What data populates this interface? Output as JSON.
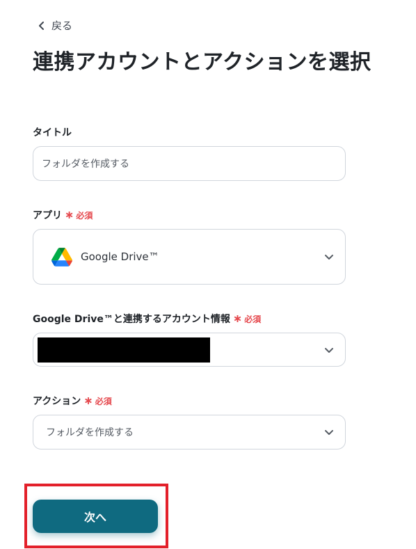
{
  "nav": {
    "back_label": "戻る"
  },
  "page": {
    "title": "連携アカウントとアクションを選択"
  },
  "required_label": "必須",
  "fields": {
    "title": {
      "label": "タイトル",
      "value": "フォルダを作成する"
    },
    "app": {
      "label": "アプリ",
      "selected": "Google Drive™",
      "icon": "google-drive-icon"
    },
    "account": {
      "label": "Google Drive™と連携するアカウント情報"
    },
    "action": {
      "label": "アクション",
      "selected": "フォルダを作成する"
    }
  },
  "buttons": {
    "next_label": "次へ"
  },
  "colors": {
    "primary": "#0f6a80",
    "required": "#e5484d",
    "highlight": "#e3202a",
    "border": "#d0d5dc"
  }
}
